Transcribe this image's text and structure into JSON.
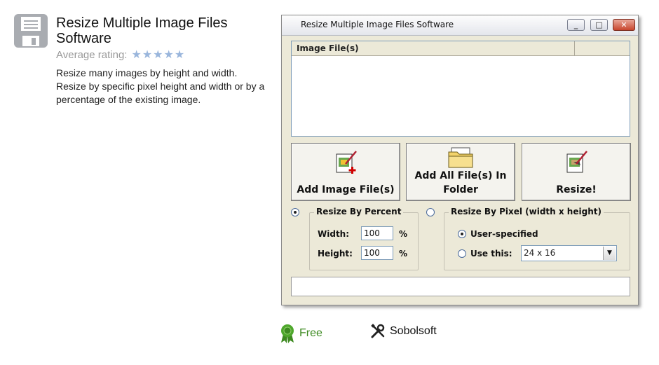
{
  "app": {
    "title": "Resize Multiple Image Files Software",
    "rating_label": "Average rating:",
    "rating_stars": 5,
    "description": "Resize many images by height and width. Resize by specific pixel height and width or by a percentage of the existing image.",
    "license": "Free",
    "developer": "Sobolsoft"
  },
  "window": {
    "title": "Resize Multiple Image Files Software",
    "list_header": "Image File(s)",
    "buttons": {
      "add": "Add Image File(s)",
      "add_folder_line1": "Add All File(s) In",
      "add_folder_line2": "Folder",
      "resize": "Resize!"
    },
    "percent_group": {
      "title": "Resize By Percent",
      "width_label": "Width:",
      "width_value": "100",
      "height_label": "Height:",
      "height_value": "100",
      "unit": "%"
    },
    "pixel_group": {
      "title": "Resize By Pixel (width x height)",
      "user_specified": "User-specified",
      "use_this": "Use this:",
      "size_value": "24 x 16"
    }
  },
  "colors": {
    "accent_green": "#3d8a21",
    "star_blue": "#9ab6dc"
  },
  "icons": {
    "app": "floppy-disk-icon",
    "license": "award-ribbon-icon",
    "developer": "tools-icon"
  }
}
